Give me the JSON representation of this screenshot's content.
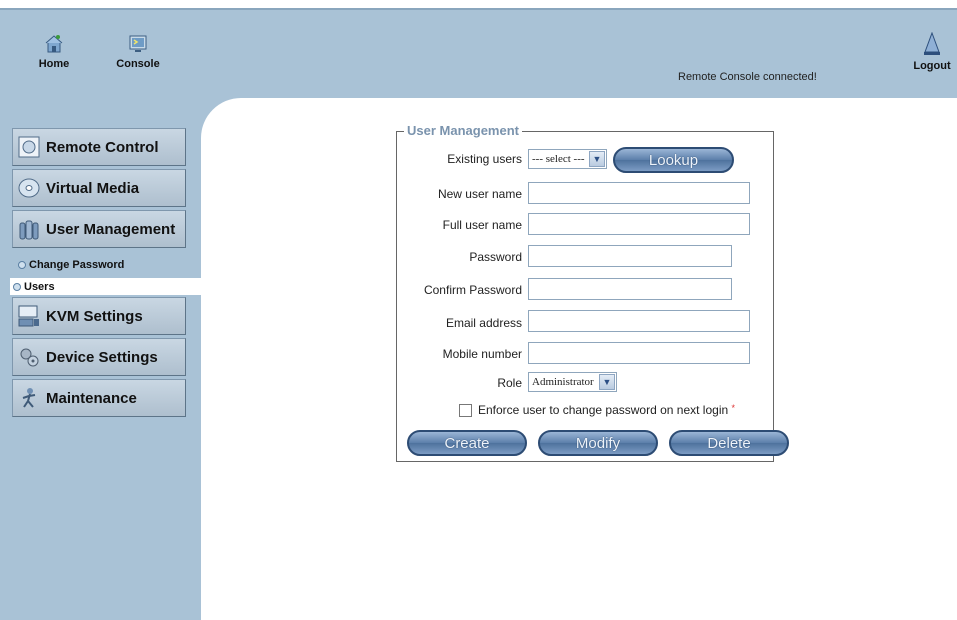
{
  "toolbar": {
    "home_label": "Home",
    "console_label": "Console",
    "logout_label": "Logout",
    "status_text": "Remote Console connected!"
  },
  "sidebar": {
    "items": [
      {
        "label": "Remote Control",
        "icon": "remote-control-icon"
      },
      {
        "label": "Virtual Media",
        "icon": "disc-icon"
      },
      {
        "label": "User Management",
        "icon": "users-icon"
      },
      {
        "label": "KVM Settings",
        "icon": "keyboard-monitor-icon"
      },
      {
        "label": "Device Settings",
        "icon": "gears-icon"
      },
      {
        "label": "Maintenance",
        "icon": "maintenance-icon"
      }
    ],
    "subitems": [
      {
        "label": "Change Password",
        "active": false
      },
      {
        "label": "Users",
        "active": true
      }
    ]
  },
  "form": {
    "legend": "User Management",
    "existing_users_label": "Existing users",
    "existing_users_value": "--- select ---",
    "lookup_label": "Lookup",
    "new_user_label": "New user name",
    "new_user_value": "",
    "full_user_label": "Full user name",
    "full_user_value": "",
    "password_label": "Password",
    "password_value": "",
    "confirm_password_label": "Confirm Password",
    "confirm_password_value": "",
    "email_label": "Email address",
    "email_value": "",
    "mobile_label": "Mobile number",
    "mobile_value": "",
    "role_label": "Role",
    "role_value": "Administrator",
    "enforce_label": "Enforce user to change password on next login",
    "enforce_required_mark": "*",
    "enforce_checked": false,
    "create_label": "Create",
    "modify_label": "Modify",
    "delete_label": "Delete"
  },
  "colors": {
    "header_bg": "#a9c2d6",
    "button_blue": "#5b7faa",
    "legend_text": "#7a93ad"
  }
}
